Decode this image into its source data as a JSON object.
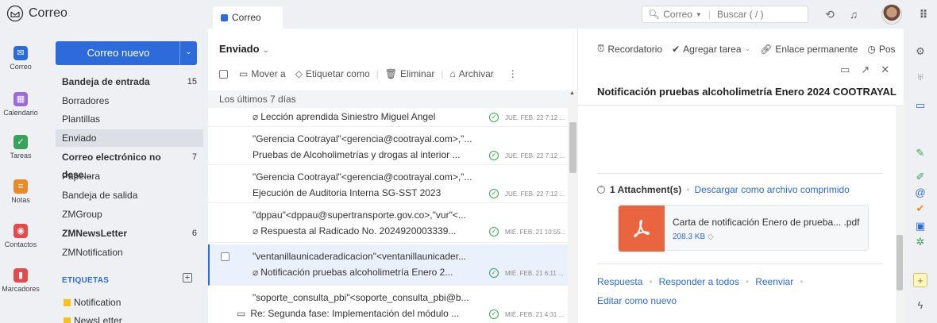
{
  "app": {
    "name": "Correo"
  },
  "tab": {
    "label": "Correo"
  },
  "search": {
    "scope": "Correo",
    "placeholder": "Buscar ( / )"
  },
  "rail": [
    {
      "label": "Correo",
      "color": "#2c6bd9",
      "glyph": "✉"
    },
    {
      "label": "Calendario",
      "color": "#9b6bd6",
      "glyph": "▦"
    },
    {
      "label": "Tareas",
      "color": "#3aa35b",
      "glyph": "✓"
    },
    {
      "label": "Notas",
      "color": "#e98b2a",
      "glyph": "≡"
    },
    {
      "label": "Contactos",
      "color": "#e24b4b",
      "glyph": "◉"
    },
    {
      "label": "Marcadores",
      "color": "#e24b4b",
      "glyph": "▮"
    }
  ],
  "new_mail": {
    "label": "Correo nuevo"
  },
  "folders": [
    {
      "name": "Bandeja de entrada",
      "count": "15",
      "bold": true
    },
    {
      "name": "Borradores",
      "count": ""
    },
    {
      "name": "Plantillas",
      "count": ""
    },
    {
      "name": "Enviado",
      "count": "",
      "active": true
    },
    {
      "name": "Correo electrónico no dese...",
      "count": "7",
      "bold": true
    },
    {
      "name": "Papelera",
      "count": ""
    },
    {
      "name": "Bandeja de salida",
      "count": ""
    },
    {
      "name": "ZMGroup",
      "count": ""
    },
    {
      "name": "ZMNewsLetter",
      "count": "6",
      "bold": true
    },
    {
      "name": "ZMNotification",
      "count": ""
    }
  ],
  "labels": {
    "header": "ETIQUETAS",
    "items": [
      "Notification",
      "NewsLetter"
    ]
  },
  "list": {
    "title": "Enviado",
    "toolbar": {
      "move": "Mover a",
      "tag": "Etiquetar como",
      "delete": "Eliminar",
      "archive": "Archivar"
    },
    "group": "Los últimos 7 días",
    "messages": [
      {
        "from": "",
        "subject": "Lección aprendida Siniestro Miguel Angel",
        "date": "JUE. FEB. 22 7:12 ...",
        "attach": true
      },
      {
        "from": "\"Gerencia Cootrayal\"<gerencia@cootrayal.com>,\"...",
        "subject": "Pruebas de Alcoholimetrías y drogas al interior ...",
        "date": "JUE. FEB. 22 7:12 ...",
        "attach": false
      },
      {
        "from": "\"Gerencia Cootrayal\"<gerencia@cootrayal.com>,\"...",
        "subject": "Ejecución de Auditoria Interna SG-SST 2023",
        "date": "JUE. FEB. 22 7:12 ...",
        "attach": false
      },
      {
        "from": "\"dppau\"<dppau@supertransporte.gov.co>,\"vur\"<...",
        "subject": "Respuesta al Radicado No. 2024920003339...",
        "date": "MIÉ. FEB. 21 10:55...",
        "attach": true
      },
      {
        "from": "\"ventanillaunicaderadicacion\"<ventanillaunicader...",
        "subject": "Notificación pruebas alcoholimetría Enero 2...",
        "date": "MIÉ. FEB. 21 6:11 ...",
        "attach": true,
        "selected": true
      },
      {
        "from": "\"soporte_consulta_pbi\"<soporte_consulta_pbi@b...",
        "subject": "Re:  Segunda fase: Implementación del módulo ...",
        "date": "MIÉ. FEB. 21 4:31 ...",
        "attach": false,
        "thread": true
      }
    ]
  },
  "reader": {
    "toolbar": {
      "reminder": "Recordatorio",
      "task": "Agregar tarea",
      "permalink": "Enlace permanente",
      "more": "Pos"
    },
    "subject": "Notificación pruebas alcoholimetría Enero 2024 COOTRAYAL",
    "attachments": {
      "count": "1 Attachment(s)",
      "download": "Descargar como archivo comprimido"
    },
    "file": {
      "name": "Carta de notificación Enero de prueba... .pdf",
      "size": "208.3 KB"
    },
    "actions": {
      "reply": "Respuesta",
      "reply_all": "Responder a todos",
      "forward": "Reenviar",
      "edit_new": "Editar como nuevo"
    }
  }
}
